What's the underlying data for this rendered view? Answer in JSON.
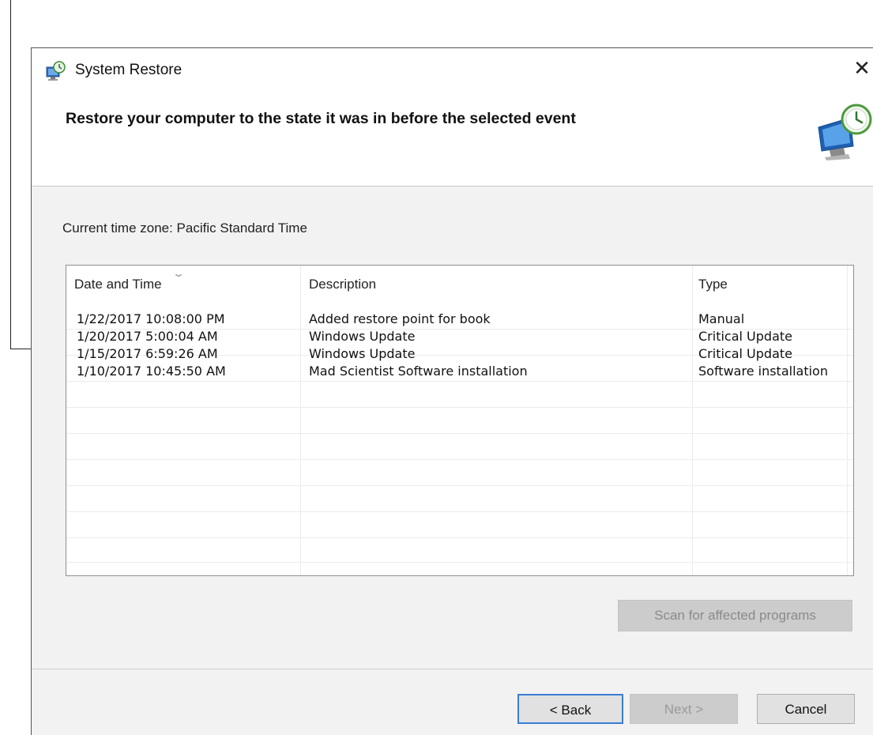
{
  "window": {
    "title": "System Restore",
    "close_glyph": "✕"
  },
  "header": {
    "title": "Restore your computer to the state it was in before the selected event"
  },
  "timezone_label": "Current time zone: Pacific Standard Time",
  "restore_points": {
    "columns": [
      "Date and Time",
      "Description",
      "Type"
    ],
    "sort_indicator": "⌄",
    "rows": [
      {
        "date": "1/22/2017 10:08:00 PM",
        "description": "Added restore point for book",
        "type": "Manual"
      },
      {
        "date": "1/20/2017 5:00:04 AM",
        "description": "Windows Update",
        "type": "Critical Update"
      },
      {
        "date": "1/15/2017 6:59:26 AM",
        "description": "Windows Update",
        "type": "Critical Update"
      },
      {
        "date": "1/10/2017 10:45:50 AM",
        "description": "Mad Scientist Software installation",
        "type": "Software installation"
      }
    ]
  },
  "buttons": {
    "scan": "Scan for affected programs",
    "back": "< Back",
    "next": "Next >",
    "cancel": "Cancel"
  },
  "icons": {
    "app": "system-restore-icon",
    "header": "restore-monitor-icon"
  },
  "colors": {
    "focus_border": "#3a7dd1",
    "disabled_button": "#cccccc",
    "body_background": "#f2f2f2"
  }
}
